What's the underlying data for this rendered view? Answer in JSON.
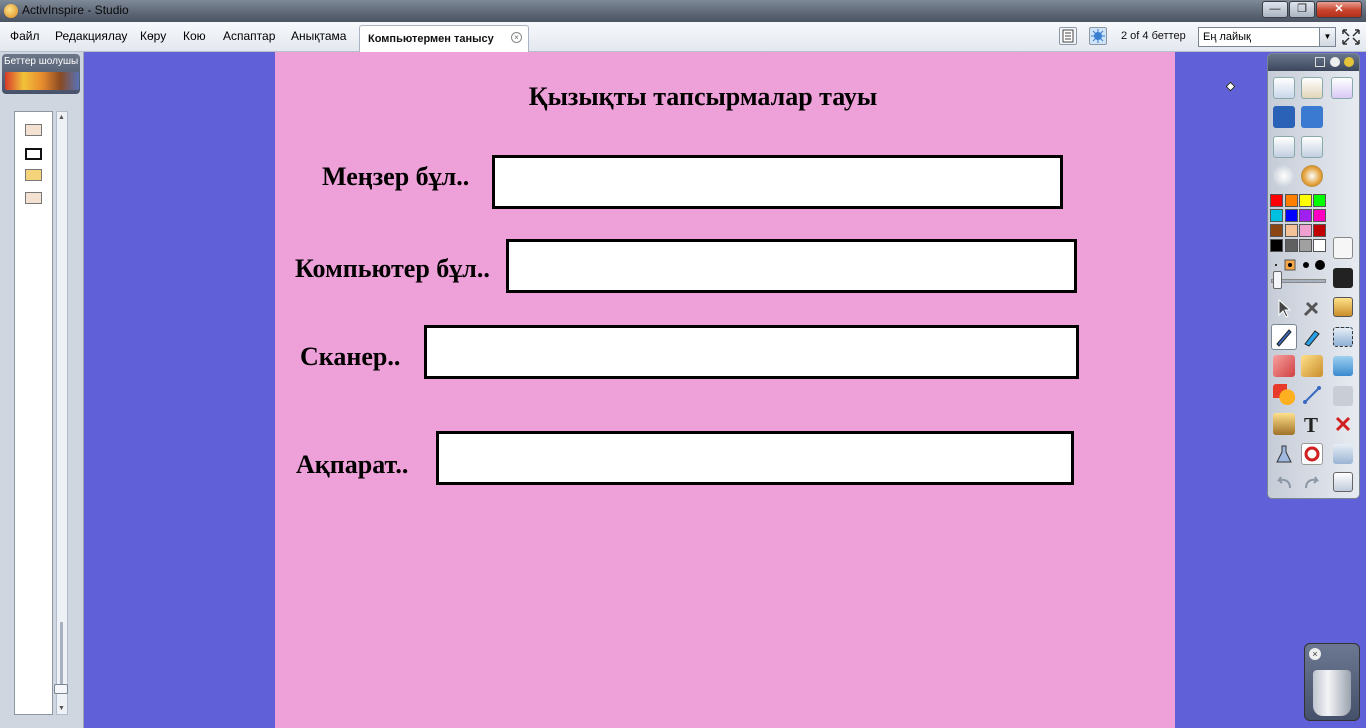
{
  "window": {
    "title": "ActivInspire - Studio",
    "controls": [
      "—",
      "❐",
      "✕"
    ]
  },
  "menu": {
    "items": [
      "Файл",
      "Редакциялау",
      "Көру",
      "Кою",
      "Аспаптар",
      "Анықтама"
    ]
  },
  "tab": {
    "label": "Компьютермен танысу"
  },
  "toolbar": {
    "page_count": "2 of 4 беттер",
    "zoom_value": "Ең лайық"
  },
  "browser": {
    "header_text": "Беттер шолушысы"
  },
  "page": {
    "title": "Қызықты тапсырмалар тауы",
    "rows": [
      {
        "label": "Меңзер бұл..",
        "value": ""
      },
      {
        "label": "Компьютер бұл..",
        "value": ""
      },
      {
        "label": "Сканер..",
        "value": ""
      },
      {
        "label": "Ақпарат..",
        "value": ""
      }
    ]
  },
  "palette": {
    "colors": [
      "#ff0000",
      "#ff8000",
      "#ffff00",
      "#00ff00",
      "#00c0e0",
      "#0000ff",
      "#a020f0",
      "#ff00c0",
      "#8b4513",
      "#f4c29a",
      "#f0a0d0",
      "#c00000",
      "#000000",
      "#606060",
      "#a0a0a0",
      "#ffffff"
    ]
  },
  "colors": {
    "desktop": "#6060d8",
    "page_background": "#eea0d8"
  }
}
